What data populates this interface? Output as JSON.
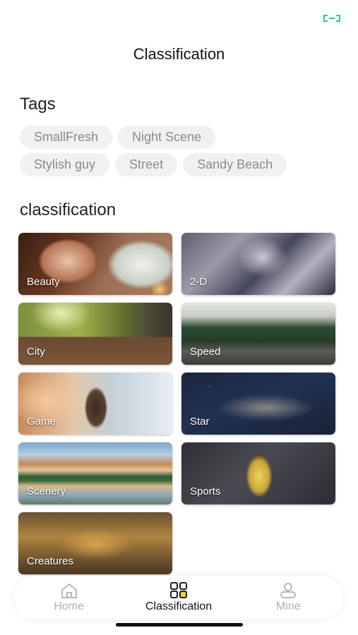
{
  "header": {
    "title": "Classification"
  },
  "tags": {
    "title": "Tags",
    "rows": [
      [
        "SmallFresh",
        "Night Scene"
      ],
      [
        "Stylish guy",
        "Street",
        "Sandy Beach"
      ]
    ]
  },
  "classification": {
    "title": "classification",
    "items": [
      {
        "label": "Beauty"
      },
      {
        "label": "2-D"
      },
      {
        "label": "City"
      },
      {
        "label": "Speed"
      },
      {
        "label": "Game"
      },
      {
        "label": "Star"
      },
      {
        "label": "Scenery"
      },
      {
        "label": "Sports"
      },
      {
        "label": "Creatures"
      }
    ]
  },
  "tabbar": {
    "tabs": [
      {
        "label": "Home",
        "icon": "home-icon"
      },
      {
        "label": "Classification",
        "icon": "grid-icon"
      },
      {
        "label": "Mine",
        "icon": "user-icon"
      }
    ],
    "active": "Classification"
  },
  "colors": {
    "accent": "#f2d130",
    "corner_icon": "#2ecc71"
  }
}
